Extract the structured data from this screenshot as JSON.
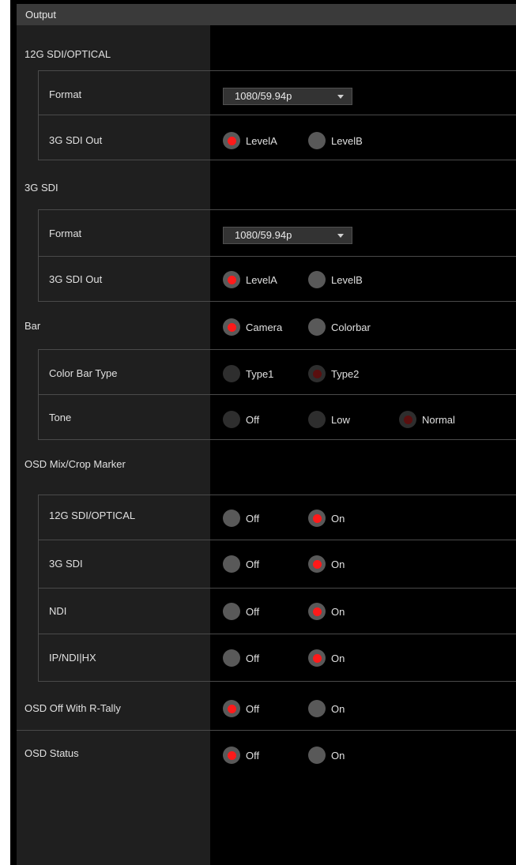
{
  "header": {
    "title": "Output"
  },
  "sdi12g": {
    "title": "12G SDI/OPTICAL",
    "format_label": "Format",
    "format_value": "1080/59.94p",
    "out_label": "3G SDI Out",
    "levelA": "LevelA",
    "levelB": "LevelB"
  },
  "sdi3g": {
    "title": "3G SDI",
    "format_label": "Format",
    "format_value": "1080/59.94p",
    "out_label": "3G SDI Out",
    "levelA": "LevelA",
    "levelB": "LevelB"
  },
  "bar": {
    "label": "Bar",
    "camera": "Camera",
    "colorbar": "Colorbar",
    "type_label": "Color Bar Type",
    "type1": "Type1",
    "type2": "Type2",
    "tone_label": "Tone",
    "tone_off": "Off",
    "tone_low": "Low",
    "tone_normal": "Normal"
  },
  "osd_mix": {
    "title": "OSD Mix/Crop Marker",
    "rows": [
      {
        "label": "12G SDI/OPTICAL",
        "off": "Off",
        "on": "On"
      },
      {
        "label": "3G SDI",
        "off": "Off",
        "on": "On"
      },
      {
        "label": "NDI",
        "off": "Off",
        "on": "On"
      },
      {
        "label": "IP/NDI|HX",
        "off": "Off",
        "on": "On"
      }
    ]
  },
  "osd_tally": {
    "label": "OSD Off With R-Tally",
    "off": "Off",
    "on": "On"
  },
  "osd_status": {
    "label": "OSD Status",
    "off": "Off",
    "on": "On"
  },
  "colors": {
    "selected": "#ff1a1a",
    "left_panel": "#1f1f1f",
    "header": "#3a3a3a"
  }
}
